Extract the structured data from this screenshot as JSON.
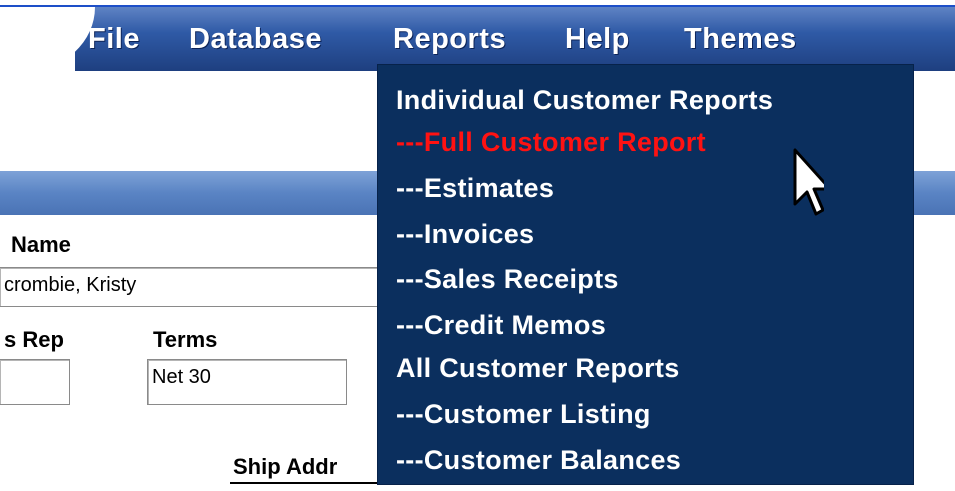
{
  "menubar": {
    "items": [
      "File",
      "Database",
      "Reports",
      "Help",
      "Themes"
    ]
  },
  "reports_menu": {
    "items": [
      {
        "label": "Individual Customer Reports",
        "active": false
      },
      {
        "label": "---Full Customer Report",
        "active": true
      },
      {
        "label": "---Estimates",
        "active": false
      },
      {
        "label": "---Invoices",
        "active": false
      },
      {
        "label": "---Sales Receipts",
        "active": false
      },
      {
        "label": "---Credit Memos",
        "active": false
      },
      {
        "label": "All Customer Reports",
        "active": false
      },
      {
        "label": "---Customer Listing",
        "active": false
      },
      {
        "label": "---Customer Balances",
        "active": false
      }
    ]
  },
  "form": {
    "name_label": "Name",
    "name_value": "crombie, Kristy",
    "sales_rep_label": "s Rep",
    "terms_label": "Terms",
    "terms_value": "Net 30",
    "ship_address_label": "Ship Addr"
  },
  "colors": {
    "menu_bg": "#0b2f5e",
    "menu_active": "#ff1212",
    "menubar": "#2f5aa6",
    "section_bar": "#5a84c4"
  },
  "icons": {
    "cursor": "arrow-cursor-icon"
  }
}
